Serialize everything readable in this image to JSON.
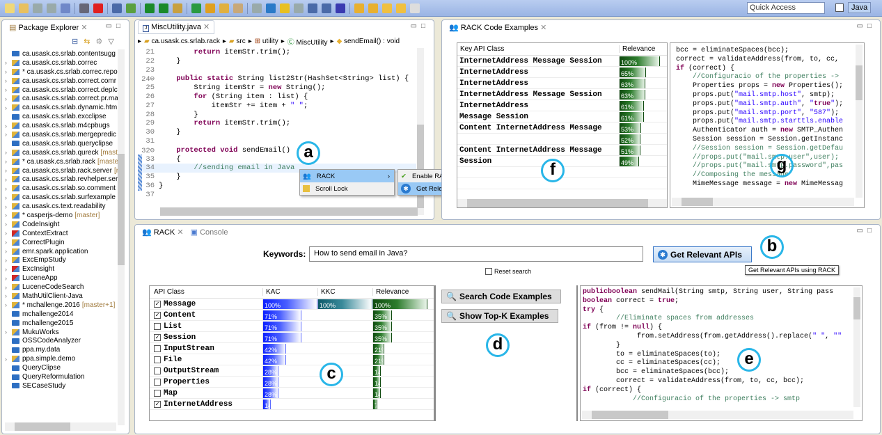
{
  "toolbar": {
    "icons": [
      "new-file",
      "new-type",
      "save",
      "save-all",
      "print",
      "binary",
      "stop",
      "debug-skip",
      "debug",
      "run",
      "external-tools",
      "new-package",
      "new-class",
      "open-folder",
      "open-type",
      "search",
      "open-task",
      "toggle-mark",
      "highlight",
      "annotation",
      "block-select",
      "show-whitespace",
      "globe",
      "next-annotation",
      "prev-annotation",
      "back",
      "forward",
      "pin"
    ],
    "quick_access": "Quick Access",
    "perspective": "Java"
  },
  "package_explorer": {
    "tab": "Package Explorer",
    "items": [
      {
        "label": "ca.usask.cs.srlab.contentsugg",
        "type": "folder",
        "arrow": false,
        "dirty": false,
        "git": ""
      },
      {
        "label": "ca.usask.cs.srlab.correc",
        "type": "project",
        "arrow": true,
        "dirty": false,
        "git": ""
      },
      {
        "label": "ca.usask.cs.srlab.correc.repo",
        "type": "project",
        "arrow": true,
        "dirty": true,
        "git": ""
      },
      {
        "label": "ca.usask.cs.srlab.correct.comr",
        "type": "project",
        "arrow": true,
        "dirty": false,
        "git": ""
      },
      {
        "label": "ca.usask.cs.srlab.correct.deplc",
        "type": "project",
        "arrow": true,
        "dirty": false,
        "git": ""
      },
      {
        "label": "ca.usask.cs.srlab.correct.pr.ma",
        "type": "project",
        "arrow": true,
        "dirty": false,
        "git": ""
      },
      {
        "label": "ca.usask.cs.srlab.dynamic.htm",
        "type": "project",
        "arrow": true,
        "dirty": false,
        "git": ""
      },
      {
        "label": "ca.usask.cs.srlab.excclipse",
        "type": "folder",
        "arrow": false,
        "dirty": false,
        "git": ""
      },
      {
        "label": "ca.usask.cs.srlab.m4cpbugs",
        "type": "project",
        "arrow": true,
        "dirty": false,
        "git": ""
      },
      {
        "label": "ca.usask.cs.srlab.mergepredic",
        "type": "project",
        "arrow": true,
        "dirty": false,
        "git": ""
      },
      {
        "label": "ca.usask.cs.srlab.queryclipse",
        "type": "folder",
        "arrow": false,
        "dirty": false,
        "git": ""
      },
      {
        "label": "ca.usask.cs.srlab.qureck",
        "type": "project",
        "arrow": true,
        "dirty": false,
        "git": "[mast"
      },
      {
        "label": "ca.usask.cs.srlab.rack",
        "type": "project",
        "arrow": true,
        "dirty": true,
        "git": "[maste"
      },
      {
        "label": "ca.usask.cs.srlab.rack.server",
        "type": "project",
        "arrow": true,
        "dirty": false,
        "git": "[r"
      },
      {
        "label": "ca.usask.cs.srlab.revhelper.ser",
        "type": "project",
        "arrow": true,
        "dirty": false,
        "git": ""
      },
      {
        "label": "ca.usask.cs.srlab.so.comment",
        "type": "project",
        "arrow": true,
        "dirty": false,
        "git": ""
      },
      {
        "label": "ca.usask.cs.srlab.surfexample",
        "type": "project",
        "arrow": true,
        "dirty": false,
        "git": ""
      },
      {
        "label": "ca.usask.cs.text.readability",
        "type": "project",
        "arrow": true,
        "dirty": false,
        "git": ""
      },
      {
        "label": "casperjs-demo",
        "type": "project",
        "arrow": true,
        "dirty": true,
        "git": "[master]"
      },
      {
        "label": "CodeInsight",
        "type": "project",
        "arrow": true,
        "dirty": false,
        "git": ""
      },
      {
        "label": "ContextExtract",
        "type": "error",
        "arrow": true,
        "dirty": false,
        "git": ""
      },
      {
        "label": "CorrectPlugin",
        "type": "project",
        "arrow": true,
        "dirty": false,
        "git": ""
      },
      {
        "label": "emr.spark.application",
        "type": "project",
        "arrow": true,
        "dirty": false,
        "git": ""
      },
      {
        "label": "ExcEmpStudy",
        "type": "project",
        "arrow": true,
        "dirty": false,
        "git": ""
      },
      {
        "label": "ExcInsight",
        "type": "error",
        "arrow": true,
        "dirty": false,
        "git": ""
      },
      {
        "label": "LuceneApp",
        "type": "error",
        "arrow": true,
        "dirty": false,
        "git": ""
      },
      {
        "label": "LuceneCodeSearch",
        "type": "project",
        "arrow": true,
        "dirty": false,
        "git": ""
      },
      {
        "label": "MathUtilClient-Java",
        "type": "project",
        "arrow": true,
        "dirty": false,
        "git": ""
      },
      {
        "label": "mchallenge.2016",
        "type": "project",
        "arrow": true,
        "dirty": true,
        "git": "[master+1]"
      },
      {
        "label": "mchallenge2014",
        "type": "folder",
        "arrow": false,
        "dirty": false,
        "git": ""
      },
      {
        "label": "mchallenge2015",
        "type": "folder",
        "arrow": false,
        "dirty": false,
        "git": ""
      },
      {
        "label": "MukuWorks",
        "type": "project",
        "arrow": true,
        "dirty": false,
        "git": ""
      },
      {
        "label": "OSSCodeAnalyzer",
        "type": "folder",
        "arrow": false,
        "dirty": false,
        "git": ""
      },
      {
        "label": "ppa.my.data",
        "type": "folder",
        "arrow": false,
        "dirty": false,
        "git": ""
      },
      {
        "label": "ppa.simple.demo",
        "type": "project",
        "arrow": true,
        "dirty": false,
        "git": ""
      },
      {
        "label": "QueryClipse",
        "type": "folder",
        "arrow": false,
        "dirty": false,
        "git": ""
      },
      {
        "label": "QueryReformulation",
        "type": "folder",
        "arrow": false,
        "dirty": false,
        "git": ""
      },
      {
        "label": "SECaseStudy",
        "type": "folder",
        "arrow": false,
        "dirty": false,
        "git": ""
      }
    ]
  },
  "editor": {
    "tab": "MiscUtility.java",
    "breadcrumb": [
      "ca.usask.cs.srlab.rack",
      "src",
      "utility",
      "MiscUtility",
      "sendEmail() : void"
    ],
    "lines": [
      {
        "n": "21",
        "html": "        <span class='kw'>return</span> itemStr.trim();"
      },
      {
        "n": "22",
        "html": "    }"
      },
      {
        "n": "23",
        "html": ""
      },
      {
        "n": "24⊖",
        "html": "    <span class='kw'>public static</span> String list2Str(HashSet&lt;String&gt; list) {"
      },
      {
        "n": "25",
        "html": "        String itemStr = <span class='kw'>new</span> String();"
      },
      {
        "n": "26",
        "html": "        <span class='kw'>for</span> (String item : list) {"
      },
      {
        "n": "27",
        "html": "            itemStr += item + <span class='st'>\" \"</span>;"
      },
      {
        "n": "28",
        "html": "        }"
      },
      {
        "n": "29",
        "html": "        <span class='kw'>return</span> itemStr.trim();"
      },
      {
        "n": "30",
        "html": "    }"
      },
      {
        "n": "31",
        "html": ""
      },
      {
        "n": "32⊖",
        "html": "    <span class='kw'>protected void</span> sendEmail()"
      },
      {
        "n": "33",
        "html": "    {"
      },
      {
        "n": "34",
        "html": "        <span class='cm'>//sending email in Java</span>",
        "hl": true
      },
      {
        "n": "35",
        "html": "    }"
      },
      {
        "n": "36",
        "html": "}"
      },
      {
        "n": "37",
        "html": ""
      }
    ]
  },
  "context_menu": {
    "items": [
      "RACK",
      "Scroll Lock"
    ],
    "submenu": [
      "Enable RACK",
      "Get Relevant APIs"
    ]
  },
  "rack_code_examples": {
    "tab": "RACK Code Examples",
    "columns": [
      "Key API Class",
      "Relevance"
    ],
    "rows": [
      {
        "api": "InternetAddress Message Session",
        "relevance": 100
      },
      {
        "api": "InternetAddress",
        "relevance": 65
      },
      {
        "api": "InternetAddress",
        "relevance": 63
      },
      {
        "api": "InternetAddress Message Session",
        "relevance": 63
      },
      {
        "api": "InternetAddress",
        "relevance": 61
      },
      {
        "api": "Message Session",
        "relevance": 61
      },
      {
        "api": "Content InternetAddress Message",
        "relevance": 53
      },
      {
        "api": "",
        "relevance": 52
      },
      {
        "api": "Content InternetAddress Message",
        "relevance": 51
      },
      {
        "api": "Session",
        "relevance": 49
      }
    ],
    "code": [
      "bcc = eliminateSpaces(bcc);",
      "correct = validateAddress(from, to, cc,",
      "if (correct) {",
      "    //Configuracio of the properties ->",
      "    Properties props = new Properties();",
      "    props.put(\"mail.smtp.host\", smtp);",
      "    props.put(\"mail.smtp.auth\", \"true\");",
      "    props.put(\"mail.smtp.port\", \"587\");",
      "    props.put(\"mail.smtp.starttls.enable",
      "    Authenticator auth = new SMTP_Authen",
      "    Session session = Session.getInstanc",
      "    //Session session = Session.getDefau",
      "    //props.put(\"mail.smtp.user\",user);",
      "    //props.put(\"mail.smtp.password\",pas",
      "    //Composing the message",
      "    MimeMessage message = new MimeMessag"
    ]
  },
  "rack_view": {
    "tabs": [
      "RACK",
      "Console"
    ],
    "keywords_label": "Keywords:",
    "keywords_value": "How to send email in Java?",
    "get_apis_button": "Get Relevant APIs",
    "tooltip": "Get Relevant APIs using RACK",
    "reset_label": "Reset search",
    "reset_checked": false,
    "api_columns": [
      "API Class",
      "KAC",
      "KKC",
      "Relevance"
    ],
    "api_rows": [
      {
        "name": "Message",
        "checked": true,
        "kac": 100,
        "kkc": 100,
        "rel": 100
      },
      {
        "name": "Content",
        "checked": true,
        "kac": 71,
        "kkc": 0,
        "rel": 35
      },
      {
        "name": "List",
        "checked": false,
        "kac": 71,
        "kkc": 0,
        "rel": 35
      },
      {
        "name": "Session",
        "checked": true,
        "kac": 71,
        "kkc": 0,
        "rel": 35
      },
      {
        "name": "InputStream",
        "checked": false,
        "kac": 42,
        "kkc": 0,
        "rel": 21
      },
      {
        "name": "File",
        "checked": false,
        "kac": 42,
        "kkc": 0,
        "rel": 21
      },
      {
        "name": "OutputStream",
        "checked": false,
        "kac": 28,
        "kkc": 0,
        "rel": 14
      },
      {
        "name": "Properties",
        "checked": false,
        "kac": 28,
        "kkc": 0,
        "rel": 14
      },
      {
        "name": "Map",
        "checked": false,
        "kac": 28,
        "kkc": 0,
        "rel": 14
      },
      {
        "name": "InternetAddress",
        "checked": true,
        "kac": 14,
        "kkc": 0,
        "rel": 7
      }
    ],
    "search_button": "Search Code Examples",
    "topk_button": "Show Top-K Examples",
    "code": [
      "public boolean sendMail(String smtp, String user, String pass",
      "    boolean correct = true;",
      "    try {",
      "        //Eliminate spaces from addresses",
      "        if (from != null) {",
      "             from.setAddress(from.getAddress().replace(\" \", \"\"",
      "        }",
      "        to = eliminateSpaces(to);",
      "        cc = eliminateSpaces(cc);",
      "        bcc = eliminateSpaces(bcc);",
      "        correct = validateAddress(from, to, cc, bcc);",
      "        if (correct) {",
      "            //Configuracio of the properties -> smtp"
    ]
  },
  "callouts": [
    "a",
    "b",
    "c",
    "d",
    "e",
    "f",
    "g"
  ]
}
